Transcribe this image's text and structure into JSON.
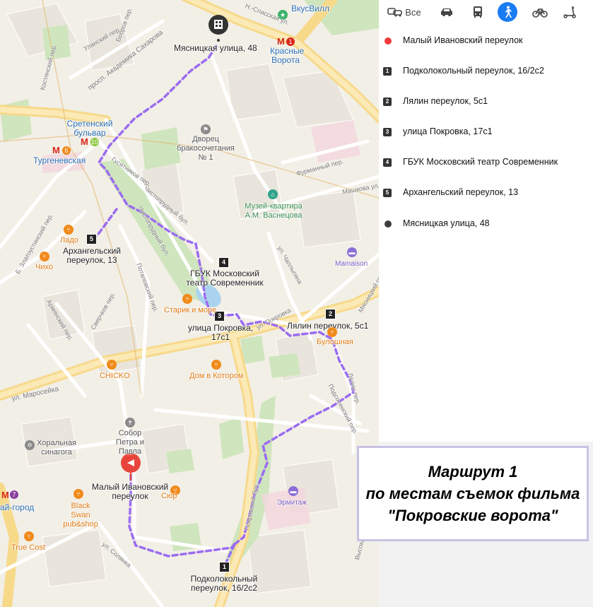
{
  "transport_modes": [
    {
      "id": "all",
      "label": "Все",
      "icon": "car-bus-icon",
      "active": false
    },
    {
      "id": "car",
      "label": "",
      "icon": "car-icon",
      "active": false
    },
    {
      "id": "transit",
      "label": "",
      "icon": "bus-icon",
      "active": false
    },
    {
      "id": "walk",
      "label": "",
      "icon": "pedestrian-icon",
      "active": true
    },
    {
      "id": "bike",
      "label": "",
      "icon": "bicycle-icon",
      "active": false
    },
    {
      "id": "scooter",
      "label": "",
      "icon": "scooter-icon",
      "active": false
    }
  ],
  "route_points": [
    {
      "marker": "",
      "label": "Малый Ивановский переулок"
    },
    {
      "marker": "1",
      "label": "Подколокольный переулок, 16/2с2"
    },
    {
      "marker": "2",
      "label": "Лялин переулок, 5с1"
    },
    {
      "marker": "3",
      "label": "улица Покровка, 17с1"
    },
    {
      "marker": "4",
      "label": "ГБУК Московский театр Современник"
    },
    {
      "marker": "5",
      "label": "Архангельский переулок, 13"
    },
    {
      "marker": "",
      "label": "Мясницкая улица, 48"
    }
  ],
  "caption": {
    "line1": "Маршрут 1",
    "line2": "по местам съемок фильма",
    "line3": "\"Покровские ворота\""
  },
  "map": {
    "start_label": "Малый Ивановский переулок",
    "end_label": "Мясницкая улица, 48",
    "stops": [
      {
        "num": "1",
        "label": "Подколокольный переулок, 16/2с2"
      },
      {
        "num": "2",
        "label": "Лялин переулок, 5с1"
      },
      {
        "num": "3",
        "label": "улица Покровка, 17с1"
      },
      {
        "num": "4",
        "label": "ГБУК Московский театр Современник"
      },
      {
        "num": "5",
        "label": "Архангельский переулок, 13"
      }
    ],
    "places": {
      "vkusvill": "ВкусВилл",
      "krasnye_vorota": "Красные Ворота",
      "sretensky": "Сретенский бульвар",
      "turgenevskaya": "Тургеневская",
      "dvorets": "Дворец бракосочетания № 1",
      "muzei": "Музей-квартира А.М. Васнецова",
      "mamaison": "Mamaison",
      "lado": "Ладо",
      "chiho": "Чихо",
      "starik": "Старик и море",
      "bulochnaya": "Булошная",
      "chicko": "CHICKO",
      "dom_v_kotorom": "Дом в Котором",
      "sobor": "Собор Петра и Павла",
      "horal": "Хоральная синагога",
      "black_swan": "Black Swan pub&shop",
      "syur": "Сюр",
      "ermitazh": "Эрмитаж",
      "true_cost": "True Cost",
      "kitai_gorod": "ай-город"
    },
    "metro_line_numbers": {
      "turgenevskaya": "6",
      "sretensky": "10",
      "krasnye_vorota": "1",
      "kitai_gorod": "7"
    },
    "streets": {
      "kalanchevskaya": "Н.-Спасская ул.",
      "sakharova": "просп. Академика Сахарова",
      "ulansky": "Уланский пер.",
      "kostyansky": "Костянский пер.",
      "bobrov": "Бобров пер.",
      "gusyatnikov": "Гусятников пер.",
      "chistoprudny1": "Чистопрудный бул.",
      "chistoprudny2": "Чистопрудный бул.",
      "furmanny": "Фурманный пер.",
      "mashkova": "Машкова ул.",
      "chaplygina": "ул. Чаплыгина",
      "pokrovka": "ул. Покровка",
      "myasnitsky": "Мясницкий пр.",
      "potapovsky": "Потаповский пер.",
      "sverchkov": "Сверчков пер.",
      "armyansky": "Армянский пер.",
      "maroseika": "ул. Маросейка",
      "podsosensky": "Подсосенский пер.",
      "lyalin": "Лялин пер.",
      "pokrovsky": "Покровский бул.",
      "solyanka": "ул. Солянка",
      "bolshoi_zlatoustinsky": "Б. Златоустинский пер.",
      "vysokiy": "Высокий пер."
    }
  }
}
